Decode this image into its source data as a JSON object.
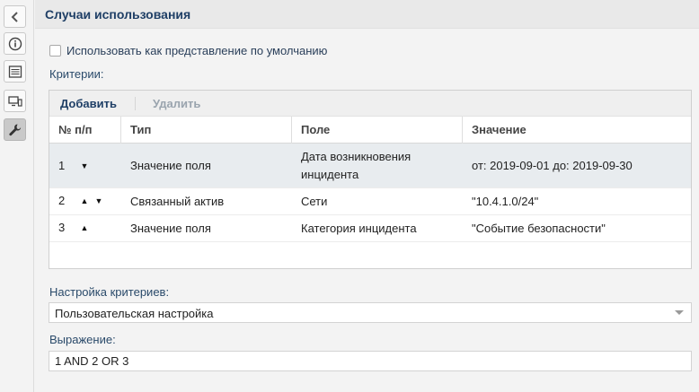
{
  "sidebar": {
    "buttons": [
      {
        "name": "back",
        "icon": "chevron-left-icon"
      },
      {
        "name": "info",
        "icon": "info-icon"
      },
      {
        "name": "list",
        "icon": "list-icon"
      },
      {
        "name": "monitor",
        "icon": "monitor-icon"
      },
      {
        "name": "settings",
        "icon": "wrench-icon",
        "active": true
      }
    ]
  },
  "header": {
    "title": "Случаи использования"
  },
  "default_view": {
    "label": "Использовать как представление по умолчанию",
    "checked": false
  },
  "criteria": {
    "label": "Критерии:",
    "toolbar": {
      "add_label": "Добавить",
      "delete_label": "Удалить"
    },
    "columns": [
      "№ п/п",
      "Тип",
      "Поле",
      "Значение"
    ],
    "rows": [
      {
        "num": "1",
        "arrows": [
          "▼"
        ],
        "type": "Значение поля",
        "field": "Дата возникновения инцидента",
        "value": "от: 2019-09-01 до: 2019-09-30",
        "selected": true
      },
      {
        "num": "2",
        "arrows": [
          "▲",
          "▼"
        ],
        "type": "Связанный актив",
        "field": "Сети",
        "value": "\"10.4.1.0/24\"",
        "selected": false
      },
      {
        "num": "3",
        "arrows": [
          "▲"
        ],
        "type": "Значение поля",
        "field": "Категория инцидента",
        "value": "\"Событие безопасности\"",
        "selected": false
      }
    ]
  },
  "criteria_settings": {
    "label": "Настройка критериев:",
    "selected": "Пользовательская настройка"
  },
  "expression": {
    "label": "Выражение:",
    "value": "1 AND 2 OR 3"
  },
  "colors": {
    "header_title": "#1f3f66",
    "selected_row": "#e8ecef",
    "disabled": "#9aa4ae"
  }
}
